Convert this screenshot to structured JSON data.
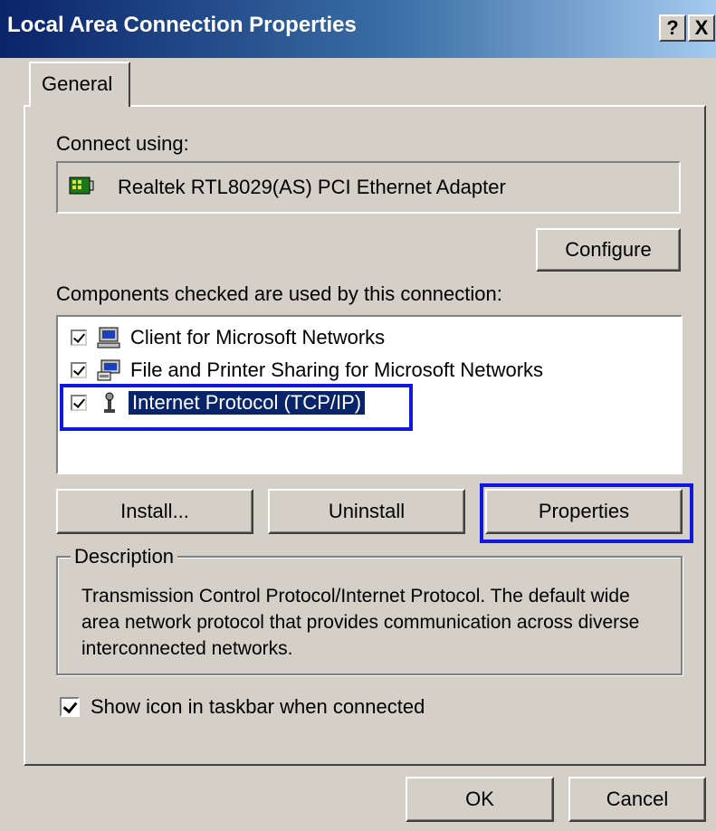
{
  "window": {
    "title": "Local Area Connection Properties",
    "help_label": "?",
    "close_label": "X"
  },
  "tabs": [
    {
      "label": "General"
    }
  ],
  "connect": {
    "label": "Connect using:",
    "adapter": "Realtek RTL8029(AS) PCI Ethernet Adapter",
    "configure_button": "Configure"
  },
  "components": {
    "label": "Components checked are used by this connection:",
    "items": [
      {
        "label": "Client for Microsoft Networks",
        "checked": true,
        "icon": "network-client-icon"
      },
      {
        "label": "File and Printer Sharing for Microsoft Networks",
        "checked": true,
        "icon": "file-printer-sharing-icon"
      },
      {
        "label": "Internet Protocol (TCP/IP)",
        "checked": true,
        "icon": "protocol-icon",
        "selected": true
      }
    ]
  },
  "buttons": {
    "install": "Install...",
    "uninstall": "Uninstall",
    "properties": "Properties"
  },
  "description": {
    "legend": "Description",
    "text": "Transmission Control Protocol/Internet Protocol. The default wide area network protocol that provides communication across diverse interconnected networks."
  },
  "taskbar_option": {
    "label": "Show icon in taskbar when connected",
    "checked": true
  },
  "footer": {
    "ok": "OK",
    "cancel": "Cancel"
  },
  "colors": {
    "titlebar_start": "#0a246a",
    "titlebar_end": "#a6caf0",
    "dialog_face": "#d4d0c8",
    "selection": "#0a246a",
    "highlight_annotation": "#1018e0"
  }
}
